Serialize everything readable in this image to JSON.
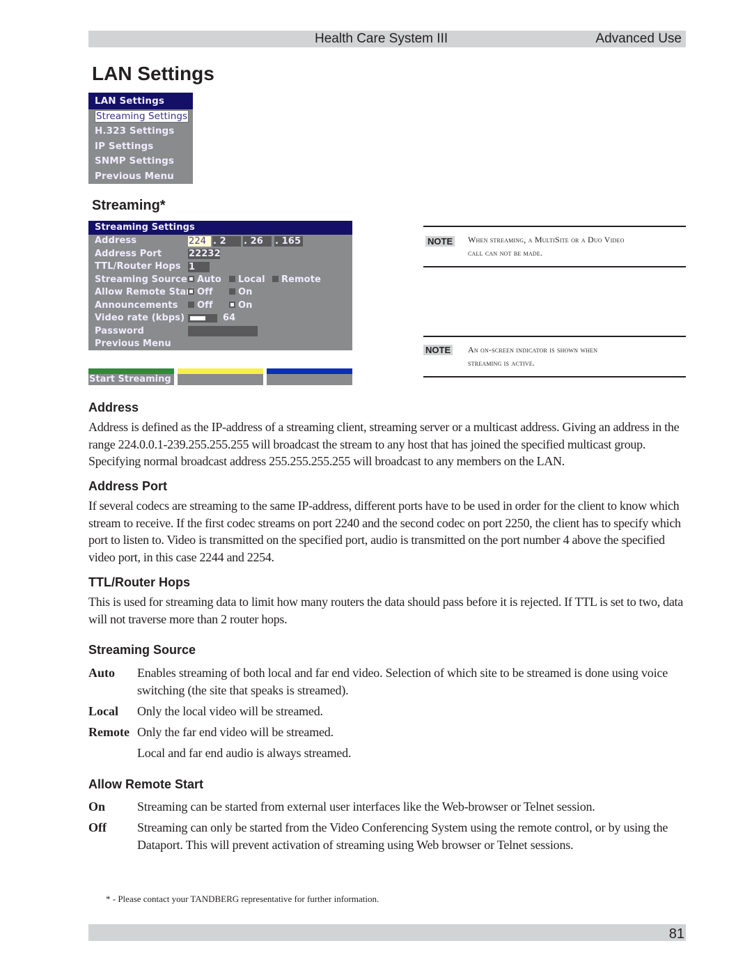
{
  "header": {
    "title": "Health Care System III",
    "section": "Advanced Use"
  },
  "page_title": "LAN Settings",
  "lan_menu": {
    "title": "LAN Settings",
    "items": [
      "Streaming Settings",
      "H.323 Settings",
      "IP Settings",
      "SNMP Settings",
      "Previous Menu"
    ],
    "selected_index": 0
  },
  "streaming_heading": "Streaming*",
  "streaming_menu": {
    "title": "Streaming Settings",
    "rows": {
      "address": {
        "label": "Address",
        "octets": [
          "224",
          ". 2",
          ". 26",
          ". 165"
        ]
      },
      "address_port": {
        "label": "Address Port",
        "value": "22232"
      },
      "ttl": {
        "label": "TTL/Router Hops",
        "value": "1"
      },
      "source": {
        "label": "Streaming Source",
        "options": [
          "Auto",
          "Local",
          "Remote"
        ],
        "selected": "Auto"
      },
      "remote_start": {
        "label": "Allow Remote Start",
        "options": [
          "Off",
          "On"
        ],
        "selected": "Off"
      },
      "announcements": {
        "label": "Announcements",
        "options": [
          "Off",
          "On"
        ],
        "selected": "On"
      },
      "video_rate": {
        "label": "Video rate (kbps)",
        "value": "64",
        "slider_fraction": 0.3
      },
      "password": {
        "label": "Password",
        "value": ""
      },
      "previous": {
        "label": "Previous Menu"
      }
    }
  },
  "softkeys": [
    {
      "label": "Start Streaming",
      "color": "#2e8b3a"
    },
    {
      "label": "",
      "color": "#f5f04a"
    },
    {
      "label": "",
      "color": "#0a2fb4"
    }
  ],
  "notes": [
    {
      "badge": "NOTE",
      "line1": "When streaming, a MultiSite or a Duo Video",
      "line2": "call can not be made."
    },
    {
      "badge": "NOTE",
      "line1": "An on-screen indicator is shown when",
      "line2": "streaming is active."
    }
  ],
  "sections": {
    "address": {
      "heading": "Address",
      "text": "Address is defined as the IP-address of a streaming client, streaming server or a multicast address. Giving an address in the range 224.0.0.1-239.255.255.255 will broadcast the stream to any host that has joined the specified multicast group. Specifying normal broadcast address 255.255.255.255 will broadcast to any members on the LAN."
    },
    "address_port": {
      "heading": "Address Port",
      "text": "If several codecs are streaming to the same IP-address, different ports have to be used in order for the client to know which stream to receive. If the first codec streams on port 2240 and the second codec on port 2250, the client has to specify which port to listen to. Video is transmitted on the specified port, audio is transmitted on the port number 4 above the specified video port, in this case 2244 and 2254."
    },
    "ttl": {
      "heading": "TTL/Router Hops",
      "text": "This is used for streaming data to limit how many routers the data should pass before it is rejected.  If TTL is set to two, data will not traverse more than 2 router hops."
    },
    "streaming_source": {
      "heading": "Streaming Source",
      "items": [
        {
          "term": "Auto",
          "desc": "Enables streaming of both local and far end video. Selection of which site to be streamed is done using voice switching (the site that speaks is streamed)."
        },
        {
          "term": "Local",
          "desc": "Only the local video will be streamed."
        },
        {
          "term": "Remote",
          "desc": "Only the far end video will be streamed."
        },
        {
          "term": "",
          "desc": "Local and far end audio is always streamed."
        }
      ]
    },
    "allow_remote_start": {
      "heading": "Allow Remote Start",
      "items": [
        {
          "term": "On",
          "desc": "Streaming can be started from external user interfaces like the Web-browser or Telnet session."
        },
        {
          "term": "Off",
          "desc": "Streaming can only be started from the Video Conferencing System using the remote control, or by using the Dataport. This will prevent activation of streaming using Web browser or Telnet sessions."
        }
      ]
    }
  },
  "footnote": "* - Please contact your TANDBERG representative for further information.",
  "page_number": "81"
}
